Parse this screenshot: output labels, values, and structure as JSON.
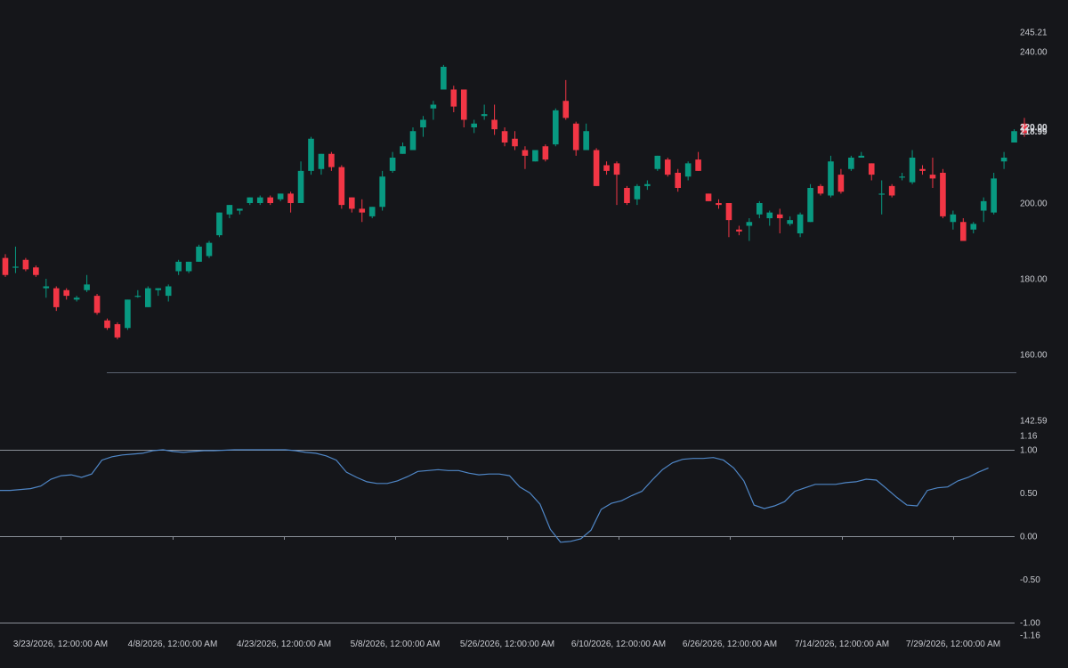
{
  "colors": {
    "background": "#15161a",
    "up": "#089981",
    "down": "#f23645",
    "oscillator_line": "#4f86c6",
    "reference_lines": "#8a8f98",
    "axis_text": "#c9cbd1"
  },
  "chart_data": [
    {
      "type": "candlestick",
      "name": "price",
      "y_axis_ticks": [
        "245.21",
        "240.00",
        "220.00",
        "200.00",
        "180.00",
        "160.00",
        "142.59"
      ],
      "ylim": [
        142.59,
        245.21
      ],
      "last_price_labels": [
        "220.00",
        "218.99"
      ],
      "x_tick_labels": [
        "3/23/2026, 12:00:00 AM",
        "4/8/2026, 12:00:00 AM",
        "4/23/2026, 12:00:00 AM",
        "5/8/2026, 12:00:00 AM",
        "5/26/2026, 12:00:00 AM",
        "6/10/2026, 12:00:00 AM",
        "6/26/2026, 12:00:00 AM",
        "7/14/2026, 12:00:00 AM",
        "7/29/2026, 12:00:00 AM"
      ],
      "candles": [
        {
          "o": 185.5,
          "h": 186.5,
          "l": 180.5,
          "c": 181
        },
        {
          "o": 183,
          "h": 188.5,
          "l": 181.5,
          "c": 183.2
        },
        {
          "o": 185,
          "h": 185.5,
          "l": 182,
          "c": 182.5
        },
        {
          "o": 183,
          "h": 183.5,
          "l": 180.5,
          "c": 181
        },
        {
          "o": 177.5,
          "h": 180,
          "l": 175,
          "c": 178
        },
        {
          "o": 177.5,
          "h": 178,
          "l": 171.5,
          "c": 172.5
        },
        {
          "o": 177,
          "h": 177.5,
          "l": 174.5,
          "c": 175.5
        },
        {
          "o": 174.5,
          "h": 175.5,
          "l": 174,
          "c": 175
        },
        {
          "o": 177,
          "h": 181,
          "l": 176.5,
          "c": 178.5
        },
        {
          "o": 175.5,
          "h": 176,
          "l": 170.5,
          "c": 171
        },
        {
          "o": 169,
          "h": 169.5,
          "l": 166.5,
          "c": 167
        },
        {
          "o": 168,
          "h": 168.5,
          "l": 164,
          "c": 164.5
        },
        {
          "o": 167,
          "h": 174.5,
          "l": 166.5,
          "c": 174.5
        },
        {
          "o": 175.5,
          "h": 177,
          "l": 175,
          "c": 175.5
        },
        {
          "o": 172.5,
          "h": 178,
          "l": 172.5,
          "c": 177.5
        },
        {
          "o": 177,
          "h": 177.5,
          "l": 175.5,
          "c": 177.5
        },
        {
          "o": 175.5,
          "h": 178.5,
          "l": 174,
          "c": 178
        },
        {
          "o": 182,
          "h": 185,
          "l": 181,
          "c": 184.5
        },
        {
          "o": 182,
          "h": 184.5,
          "l": 181.5,
          "c": 184.5
        },
        {
          "o": 184.5,
          "h": 189,
          "l": 184.5,
          "c": 188.5
        },
        {
          "o": 186,
          "h": 190,
          "l": 185.5,
          "c": 189.5
        },
        {
          "o": 191.5,
          "h": 197.5,
          "l": 191,
          "c": 197.5
        },
        {
          "o": 197,
          "h": 199.5,
          "l": 196,
          "c": 199.5
        },
        {
          "o": 198,
          "h": 198.5,
          "l": 197,
          "c": 198.5
        },
        {
          "o": 200,
          "h": 201.5,
          "l": 199.5,
          "c": 201.5
        },
        {
          "o": 200,
          "h": 202,
          "l": 199.5,
          "c": 201.5
        },
        {
          "o": 201.5,
          "h": 202,
          "l": 199.5,
          "c": 200
        },
        {
          "o": 201,
          "h": 202.5,
          "l": 200.5,
          "c": 202.5
        },
        {
          "o": 202.5,
          "h": 203,
          "l": 197.5,
          "c": 200
        },
        {
          "o": 200,
          "h": 211,
          "l": 200,
          "c": 208.5
        },
        {
          "o": 208.5,
          "h": 217.5,
          "l": 207.5,
          "c": 217
        },
        {
          "o": 209,
          "h": 213,
          "l": 207.5,
          "c": 213
        },
        {
          "o": 213,
          "h": 213.5,
          "l": 208.5,
          "c": 209.5
        },
        {
          "o": 209.5,
          "h": 210,
          "l": 198.5,
          "c": 199.5
        },
        {
          "o": 201.5,
          "h": 201.5,
          "l": 197.5,
          "c": 198.5
        },
        {
          "o": 198.5,
          "h": 201,
          "l": 195,
          "c": 197.5
        },
        {
          "o": 196.5,
          "h": 199,
          "l": 196,
          "c": 199
        },
        {
          "o": 199,
          "h": 208.5,
          "l": 198,
          "c": 207
        },
        {
          "o": 208.5,
          "h": 213.5,
          "l": 208,
          "c": 212
        },
        {
          "o": 213,
          "h": 216,
          "l": 213,
          "c": 215
        },
        {
          "o": 214,
          "h": 220,
          "l": 214,
          "c": 219
        },
        {
          "o": 220,
          "h": 223,
          "l": 217.5,
          "c": 222
        },
        {
          "o": 225,
          "h": 227,
          "l": 222,
          "c": 226
        },
        {
          "o": 230,
          "h": 236.5,
          "l": 230,
          "c": 236
        },
        {
          "o": 230,
          "h": 231,
          "l": 224,
          "c": 225.5
        },
        {
          "o": 230,
          "h": 230,
          "l": 220,
          "c": 222
        },
        {
          "o": 220,
          "h": 222,
          "l": 218.5,
          "c": 221
        },
        {
          "o": 223,
          "h": 226,
          "l": 222,
          "c": 223.5
        },
        {
          "o": 222,
          "h": 226,
          "l": 218,
          "c": 219.5
        },
        {
          "o": 219,
          "h": 220,
          "l": 215,
          "c": 216
        },
        {
          "o": 217,
          "h": 219,
          "l": 214,
          "c": 215
        },
        {
          "o": 214,
          "h": 215,
          "l": 209,
          "c": 212.5
        },
        {
          "o": 211,
          "h": 214,
          "l": 211,
          "c": 214
        },
        {
          "o": 215,
          "h": 215.5,
          "l": 211,
          "c": 211.5
        },
        {
          "o": 215.5,
          "h": 225,
          "l": 215,
          "c": 224.5
        },
        {
          "o": 227,
          "h": 232.5,
          "l": 222,
          "c": 222.5
        },
        {
          "o": 221,
          "h": 221.5,
          "l": 212.5,
          "c": 214
        },
        {
          "o": 214,
          "h": 221,
          "l": 214,
          "c": 219
        },
        {
          "o": 214,
          "h": 214.5,
          "l": 204.5,
          "c": 204.5
        },
        {
          "o": 210,
          "h": 211,
          "l": 207.5,
          "c": 208.5
        },
        {
          "o": 210.5,
          "h": 211,
          "l": 199.5,
          "c": 207.5
        },
        {
          "o": 204,
          "h": 204.5,
          "l": 199.5,
          "c": 200
        },
        {
          "o": 201,
          "h": 205,
          "l": 199.5,
          "c": 204.5
        },
        {
          "o": 204.5,
          "h": 206,
          "l": 203.5,
          "c": 205
        },
        {
          "o": 209,
          "h": 212.5,
          "l": 208.5,
          "c": 212.5
        },
        {
          "o": 211.5,
          "h": 212,
          "l": 207,
          "c": 207.5
        },
        {
          "o": 208,
          "h": 209,
          "l": 203,
          "c": 204
        },
        {
          "o": 207,
          "h": 211,
          "l": 206,
          "c": 210.5
        },
        {
          "o": 211.5,
          "h": 213.5,
          "l": 208.5,
          "c": 208.5
        },
        {
          "o": 202.5,
          "h": 202.5,
          "l": 200.5,
          "c": 200.5
        },
        {
          "o": 200,
          "h": 201,
          "l": 198.5,
          "c": 199.5
        },
        {
          "o": 200,
          "h": 200,
          "l": 191,
          "c": 195.5
        },
        {
          "o": 193,
          "h": 194,
          "l": 191.5,
          "c": 192.5
        },
        {
          "o": 194,
          "h": 196,
          "l": 190,
          "c": 195
        },
        {
          "o": 197,
          "h": 200.5,
          "l": 196,
          "c": 200
        },
        {
          "o": 196,
          "h": 198,
          "l": 194,
          "c": 197.5
        },
        {
          "o": 197,
          "h": 198.5,
          "l": 192,
          "c": 196
        },
        {
          "o": 194.5,
          "h": 196.5,
          "l": 194,
          "c": 195.5
        },
        {
          "o": 192,
          "h": 197.5,
          "l": 191,
          "c": 197
        },
        {
          "o": 195,
          "h": 205,
          "l": 195,
          "c": 204
        },
        {
          "o": 204.5,
          "h": 205,
          "l": 202,
          "c": 202.5
        },
        {
          "o": 202,
          "h": 212.5,
          "l": 201.5,
          "c": 211
        },
        {
          "o": 207.5,
          "h": 209,
          "l": 202.5,
          "c": 203
        },
        {
          "o": 209,
          "h": 212.5,
          "l": 208.5,
          "c": 212
        },
        {
          "o": 212,
          "h": 213.5,
          "l": 212,
          "c": 212.5
        },
        {
          "o": 210.5,
          "h": 210.5,
          "l": 206,
          "c": 207.5
        },
        {
          "o": 202.5,
          "h": 206,
          "l": 197,
          "c": 202.5
        },
        {
          "o": 204.5,
          "h": 205,
          "l": 201.5,
          "c": 202
        },
        {
          "o": 207,
          "h": 208,
          "l": 206,
          "c": 207
        },
        {
          "o": 205.5,
          "h": 214,
          "l": 205,
          "c": 212
        },
        {
          "o": 209,
          "h": 210,
          "l": 207.5,
          "c": 208.5
        },
        {
          "o": 207.5,
          "h": 212,
          "l": 204,
          "c": 206.5
        },
        {
          "o": 208,
          "h": 209,
          "l": 196,
          "c": 196.5
        },
        {
          "o": 195,
          "h": 198,
          "l": 193,
          "c": 197
        },
        {
          "o": 195,
          "h": 196,
          "l": 190,
          "c": 190
        },
        {
          "o": 193,
          "h": 195,
          "l": 192,
          "c": 194.5
        },
        {
          "o": 198,
          "h": 201.5,
          "l": 195,
          "c": 200.5
        },
        {
          "o": 197.5,
          "h": 208,
          "l": 197,
          "c": 206.5
        },
        {
          "o": 211,
          "h": 213.5,
          "l": 209,
          "c": 212
        },
        {
          "o": 216,
          "h": 219.5,
          "l": 216,
          "c": 219
        },
        {
          "o": 221,
          "h": 222.5,
          "l": 217.5,
          "c": 218.5
        }
      ]
    },
    {
      "type": "line",
      "name": "oscillator",
      "y_axis_ticks": [
        "1.16",
        "1.00",
        "0.50",
        "0.00",
        "-0.50",
        "-1.00",
        "-1.16"
      ],
      "ylim": [
        -1.16,
        1.16
      ],
      "reference_levels": [
        1.0,
        0.0,
        -1.0
      ],
      "values": [
        0.53,
        0.53,
        0.54,
        0.55,
        0.58,
        0.66,
        0.7,
        0.71,
        0.68,
        0.72,
        0.88,
        0.92,
        0.94,
        0.95,
        0.96,
        0.99,
        1.0,
        0.98,
        0.97,
        0.98,
        0.99,
        0.99,
        0.995,
        1.0,
        1.0,
        1.0,
        1.0,
        1.0,
        1.0,
        0.99,
        0.97,
        0.96,
        0.93,
        0.88,
        0.74,
        0.68,
        0.63,
        0.61,
        0.61,
        0.64,
        0.69,
        0.75,
        0.76,
        0.77,
        0.76,
        0.76,
        0.73,
        0.71,
        0.72,
        0.72,
        0.7,
        0.57,
        0.5,
        0.37,
        0.08,
        -0.07,
        -0.06,
        -0.03,
        0.07,
        0.31,
        0.38,
        0.41,
        0.47,
        0.52,
        0.65,
        0.77,
        0.85,
        0.89,
        0.9,
        0.9,
        0.91,
        0.88,
        0.79,
        0.64,
        0.36,
        0.32,
        0.35,
        0.4,
        0.52,
        0.56,
        0.6,
        0.6,
        0.6,
        0.62,
        0.63,
        0.66,
        0.65,
        0.55,
        0.45,
        0.36,
        0.35,
        0.53,
        0.56,
        0.57,
        0.64,
        0.68,
        0.74,
        0.79
      ]
    }
  ]
}
